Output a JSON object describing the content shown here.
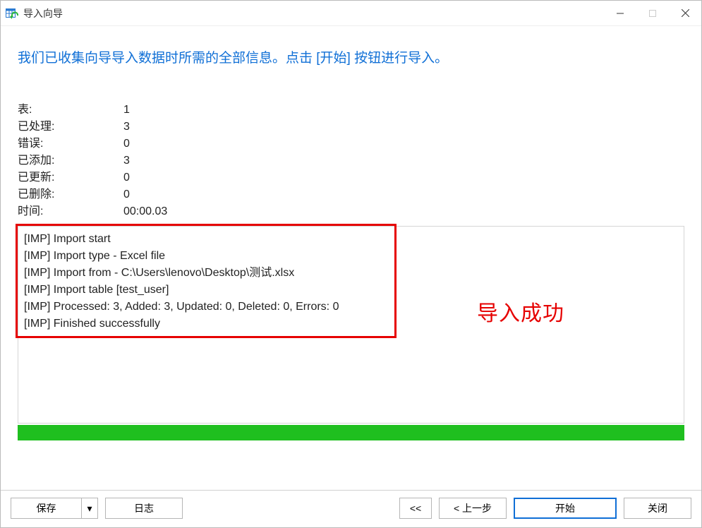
{
  "window": {
    "title": "导入向导"
  },
  "instruction": "我们已收集向导导入数据时所需的全部信息。点击 [开始] 按钮进行导入。",
  "stats": {
    "tables_label": "表:",
    "tables_value": "1",
    "processed_label": "已处理:",
    "processed_value": "3",
    "errors_label": "错误:",
    "errors_value": "0",
    "added_label": "已添加:",
    "added_value": "3",
    "updated_label": "已更新:",
    "updated_value": "0",
    "deleted_label": "已删除:",
    "deleted_value": "0",
    "time_label": "时间:",
    "time_value": "00:00.03"
  },
  "log": "[IMP] Import start\n[IMP] Import type - Excel file\n[IMP] Import from - C:\\Users\\lenovo\\Desktop\\测试.xlsx\n[IMP] Import table [test_user]\n[IMP] Processed: 3, Added: 3, Updated: 0, Deleted: 0, Errors: 0\n[IMP] Finished successfully",
  "annotation": {
    "success": "导入成功"
  },
  "buttons": {
    "save": "保存",
    "save_drop": "▾",
    "log": "日志",
    "first": "<<",
    "prev": "< 上一步",
    "start": "开始",
    "close": "关闭"
  }
}
